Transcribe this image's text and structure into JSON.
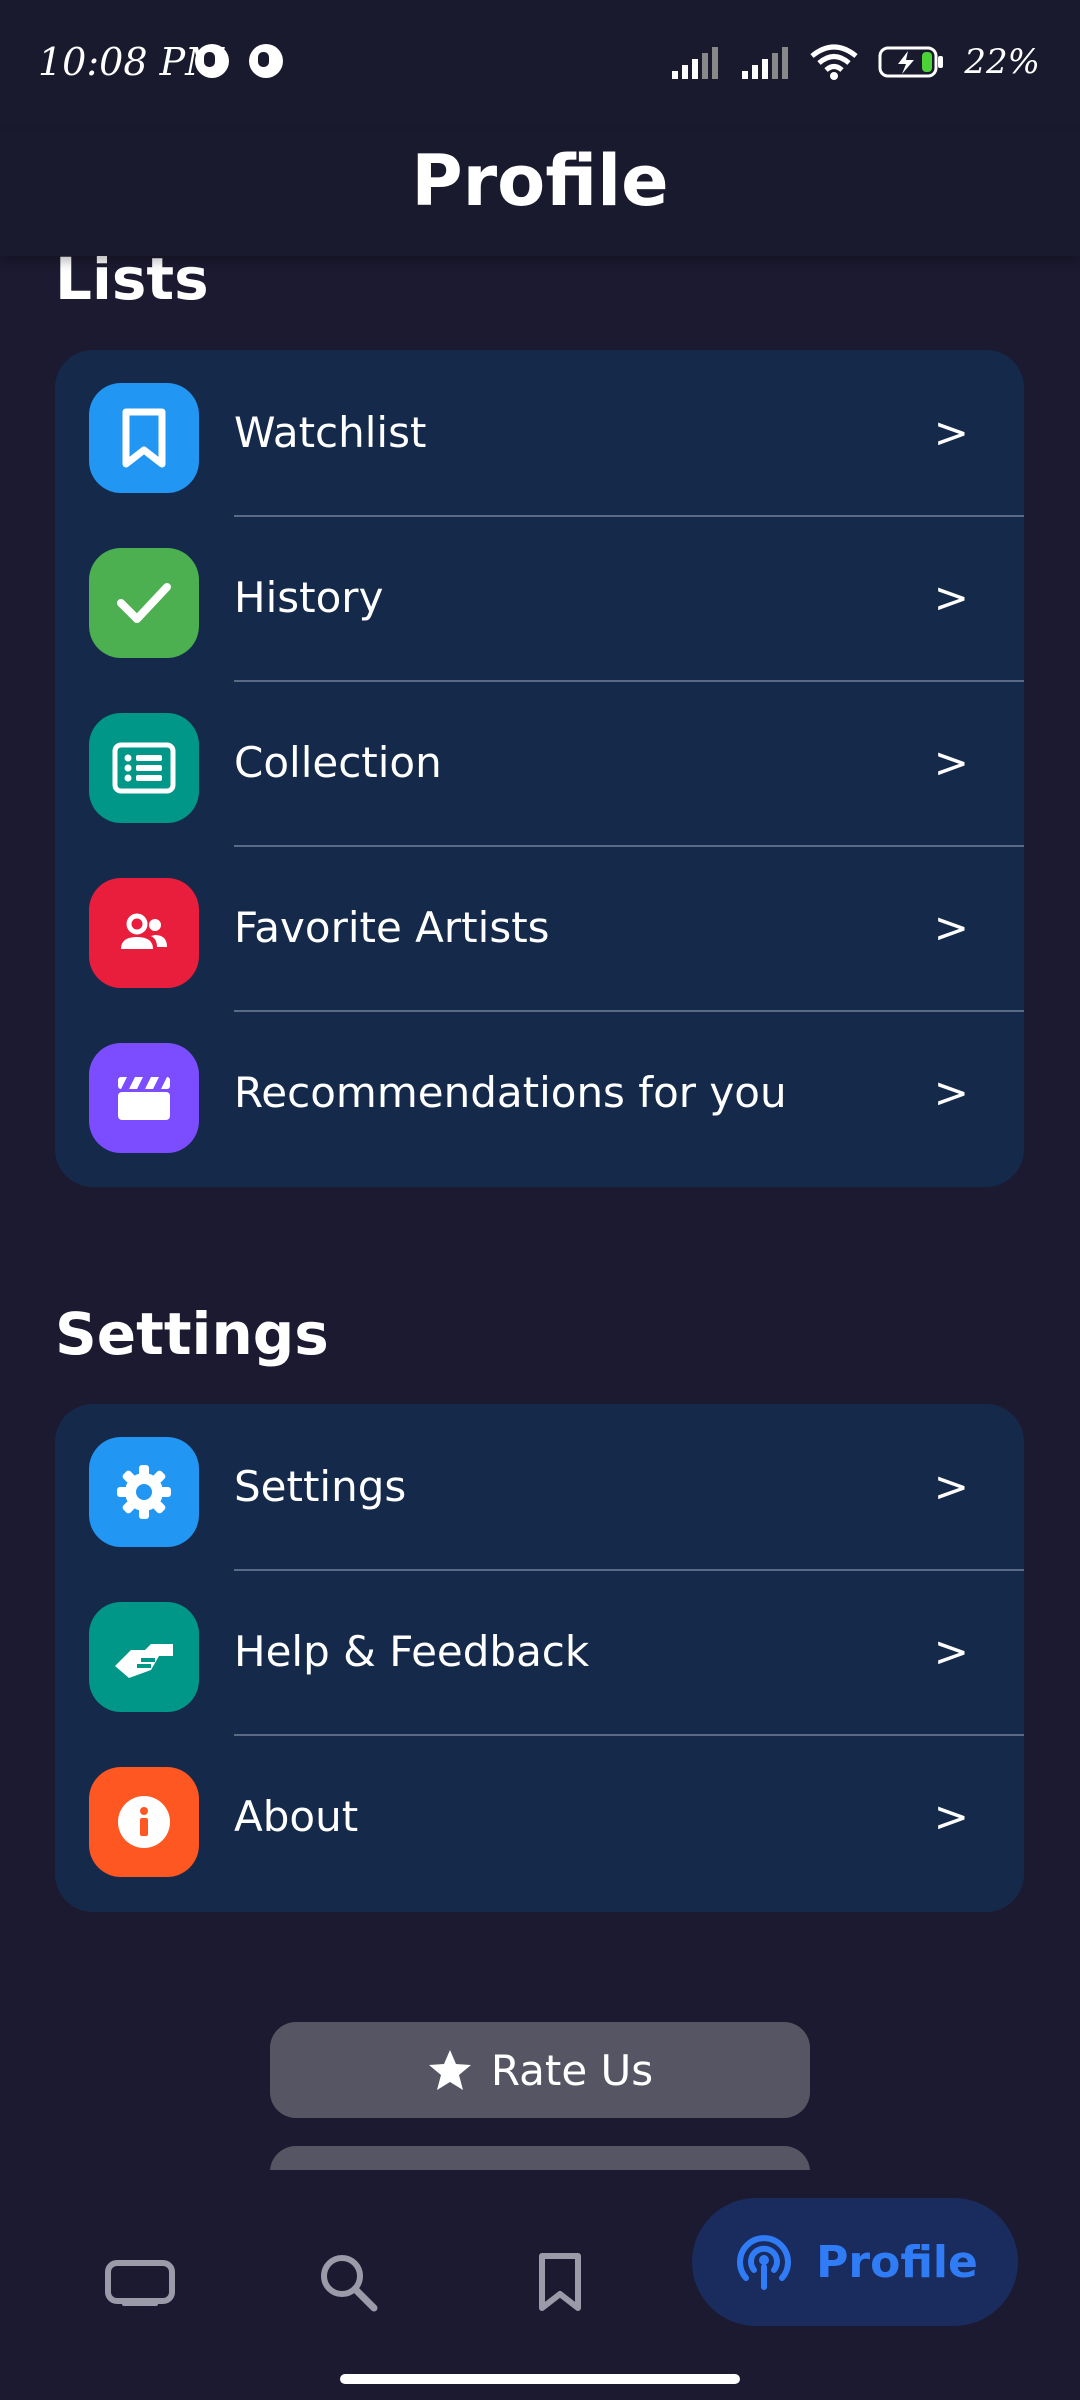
{
  "status_bar": {
    "time": "10:08 PM",
    "battery": "22%",
    "icons": [
      "notification-icon",
      "notification-icon",
      "signal-icon",
      "signal-icon",
      "wifi-icon",
      "battery-charging-icon"
    ]
  },
  "header": {
    "title": "Profile"
  },
  "lists": {
    "title": "Lists",
    "items": [
      {
        "label": "Watchlist",
        "arrow": ">",
        "icon": "bookmark-icon",
        "color": "#2196F3"
      },
      {
        "label": "History",
        "arrow": ">",
        "icon": "check-icon",
        "color": "#4CAF50"
      },
      {
        "label": "Collection",
        "arrow": ">",
        "icon": "list-icon",
        "color": "#009688"
      },
      {
        "label": "Favorite Artists",
        "arrow": ">",
        "icon": "people-icon",
        "color": "#E91E3C"
      },
      {
        "label": "Recommendations for you",
        "arrow": ">",
        "icon": "clapperboard-icon",
        "color": "#7C4DFF"
      }
    ]
  },
  "settings": {
    "title": "Settings",
    "items": [
      {
        "label": "Settings",
        "arrow": ">",
        "icon": "gear-icon",
        "color": "#2196F3"
      },
      {
        "label": "Help & Feedback",
        "arrow": ">",
        "icon": "handshake-icon",
        "color": "#009688"
      },
      {
        "label": "About",
        "arrow": ">",
        "icon": "info-icon",
        "color": "#FF5722"
      }
    ]
  },
  "buttons": {
    "rate_us": "Rate Us"
  },
  "bottom_nav": {
    "items": [
      "tv-icon",
      "search-icon",
      "bookmark-icon"
    ],
    "active_label": "Profile",
    "active_icon": "podcast-icon",
    "active_color": "#2F7CF6"
  }
}
